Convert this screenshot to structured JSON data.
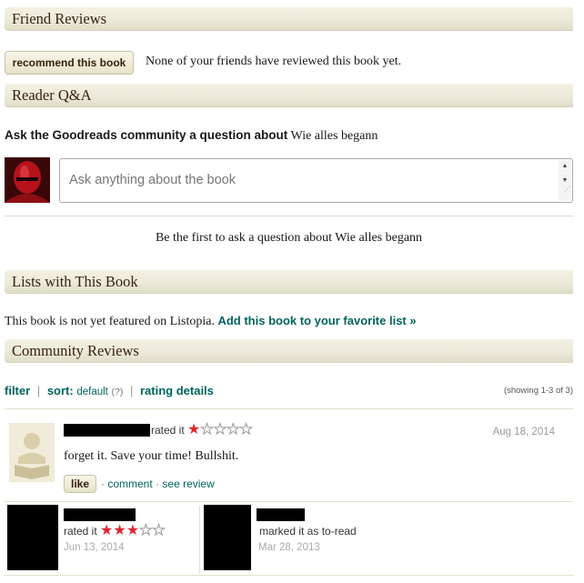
{
  "friend_reviews": {
    "header": "Friend Reviews",
    "recommend_label": "recommend this book",
    "none_text": "None of your friends have reviewed this book yet."
  },
  "reader_qa": {
    "header": "Reader Q&A",
    "ask_prefix": "Ask the Goodreads community a question about",
    "book_title": "Wie alles begann",
    "placeholder": "Ask anything about the book",
    "first_to_ask": "Be the first to ask a question about Wie alles begann"
  },
  "lists": {
    "header": "Lists with This Book",
    "not_featured": "This book is not yet featured on Listopia.",
    "add_link": "Add this book to your favorite list »"
  },
  "community_reviews": {
    "header": "Community Reviews",
    "filter_label": "filter",
    "sort_label": "sort",
    "sort_value": "default",
    "sort_help": "(?)",
    "rating_details": "rating details",
    "showing": "(showing 1-3 of 3)",
    "reviews": [
      {
        "action": "rated it",
        "rating": 1,
        "date": "Aug 18, 2014",
        "text": "forget it. Save your time! Bullshit.",
        "like_label": "like",
        "comment_label": "comment",
        "see_review_label": "see review",
        "separator": "·"
      },
      {
        "action": "rated it",
        "rating": 3,
        "date": "Jun 13, 2014"
      },
      {
        "action": "marked it as to-read",
        "date": "Mar 28, 2013"
      }
    ]
  },
  "colors": {
    "link": "#00635d",
    "star": "#e1252e",
    "header_text": "#382110"
  }
}
